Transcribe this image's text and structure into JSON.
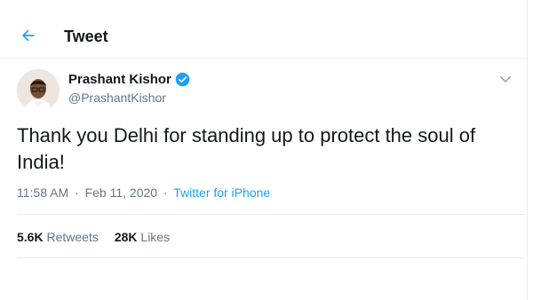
{
  "header": {
    "title": "Tweet",
    "back_icon": "arrow-left-icon"
  },
  "author": {
    "name": "Prashant Kishor",
    "handle": "@PrashantKishor",
    "verified_icon": "verified-badge-icon"
  },
  "tweet": {
    "text": "Thank you Delhi for standing up to protect the soul of India!"
  },
  "meta": {
    "time": "11:58 AM",
    "separator": "·",
    "date": "Feb 11, 2020",
    "source": "Twitter for iPhone"
  },
  "stats": {
    "retweets_count": "5.6K",
    "retweets_label": "Retweets",
    "likes_count": "28K",
    "likes_label": "Likes"
  },
  "colors": {
    "accent": "#1da1f2",
    "text": "#14171a",
    "muted": "#657786",
    "border": "#e6ecf0"
  }
}
